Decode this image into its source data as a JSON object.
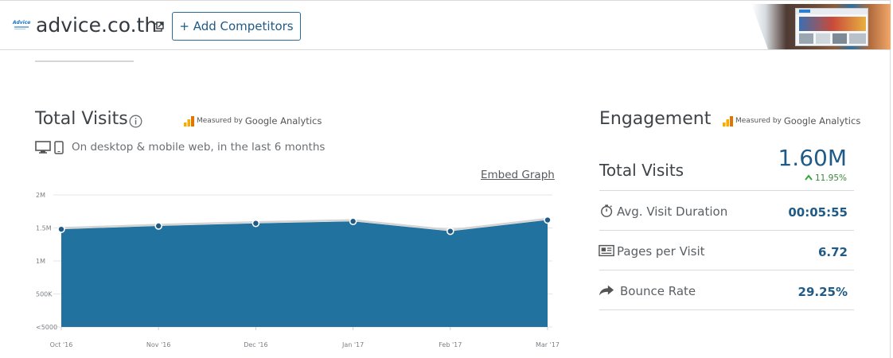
{
  "header": {
    "favicon_text": "Advice",
    "site_name": "advice.co.th",
    "add_competitors_label": "+ Add Competitors"
  },
  "total_visits": {
    "title": "Total Visits",
    "ga_measured": "Measured by",
    "ga_brand": "Google Analytics",
    "subtitle": "On desktop & mobile web, in the last 6 months",
    "embed_label": "Embed Graph"
  },
  "chart_data": {
    "type": "area",
    "x": [
      "Oct '16",
      "Nov '16",
      "Dec '16",
      "Jan '17",
      "Feb '17",
      "Mar '17"
    ],
    "series": [
      {
        "values": [
          1480000,
          1530000,
          1570000,
          1600000,
          1450000,
          1620000
        ]
      }
    ],
    "y_ticks": [
      "2M",
      "1.5M",
      "1M",
      "500K",
      "<5000"
    ],
    "y_tick_values": [
      2000000,
      1500000,
      1000000,
      500000,
      0
    ],
    "ylim": [
      0,
      2000000
    ],
    "grid": true,
    "colors": {
      "fill": "#21729e",
      "line": "#d4d4d4",
      "point": "#1f5b86"
    }
  },
  "engagement": {
    "title": "Engagement",
    "ga_measured": "Measured by",
    "ga_brand": "Google Analytics",
    "total_visits_label": "Total Visits",
    "total_visits_value": "1.60M",
    "total_visits_change": "11.95%",
    "rows": [
      {
        "icon": "stopwatch-icon",
        "label": "Avg. Visit Duration",
        "value": "00:05:55"
      },
      {
        "icon": "pages-icon",
        "label": "Pages per Visit",
        "value": "6.72"
      },
      {
        "icon": "bounce-arrow-icon",
        "label": "Bounce Rate",
        "value": "29.25%"
      }
    ],
    "colors": {
      "value": "#1f5b86",
      "change_up": "#3aa43a"
    }
  }
}
